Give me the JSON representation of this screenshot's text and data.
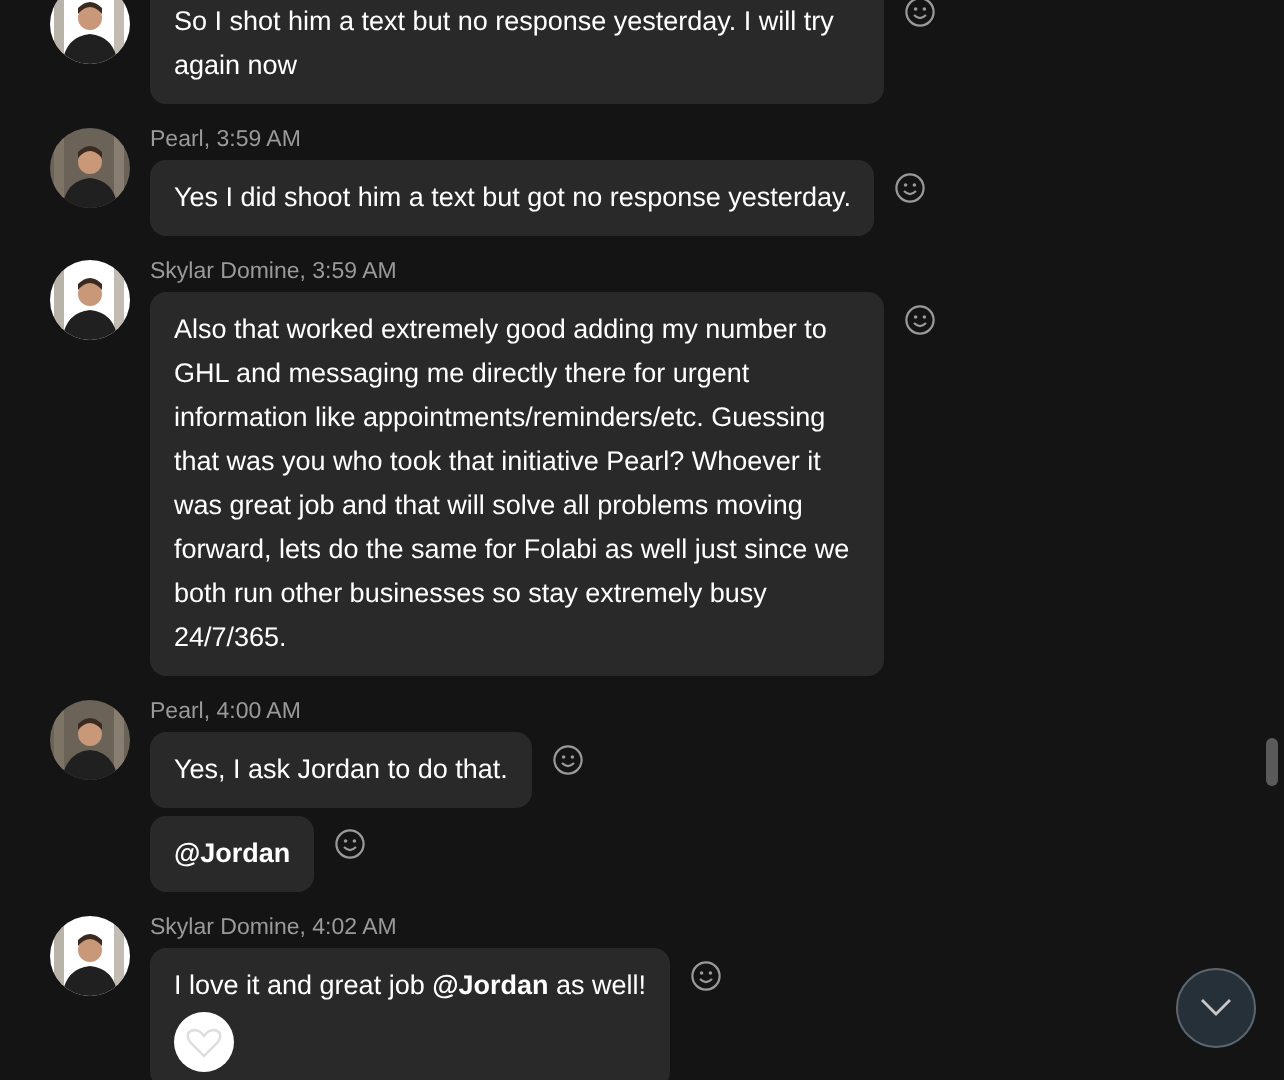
{
  "groups": [
    {
      "avatar": {
        "kind": "picture"
      },
      "messages": [
        {
          "kind": "text",
          "text": "So I shot him a text but no response yesterday. I will try again now"
        }
      ]
    },
    {
      "header": "Pearl, 3:59 AM",
      "avatar": {
        "kind": "picture"
      },
      "messages": [
        {
          "kind": "text",
          "text": "Yes I did shoot him a text but got no response yesterday."
        }
      ]
    },
    {
      "header": "Skylar Domine, 3:59 AM",
      "avatar": {
        "kind": "picture"
      },
      "messages": [
        {
          "kind": "text",
          "text": "Also that worked extremely good adding my number to GHL and messaging me directly there for urgent information like appointments/reminders/etc. Guessing that was you who took that initiative Pearl?  Whoever it was great job and that will solve all problems moving forward, lets do the same for Folabi as well just since we both run other businesses so stay extremely busy 24/7/365."
        }
      ]
    },
    {
      "header": "Pearl, 4:00 AM",
      "avatar": {
        "kind": "picture"
      },
      "messages": [
        {
          "kind": "text",
          "text": "Yes, I ask Jordan to do that."
        },
        {
          "kind": "mention",
          "text": "@Jordan"
        }
      ]
    },
    {
      "header": "Skylar Domine, 4:02 AM",
      "avatar": {
        "kind": "picture"
      },
      "messages": [
        {
          "kind": "text",
          "text": "I love it and great job **@Jordan** as well!",
          "reactions": [
            {
              "kind": "heart"
            }
          ]
        }
      ]
    }
  ]
}
